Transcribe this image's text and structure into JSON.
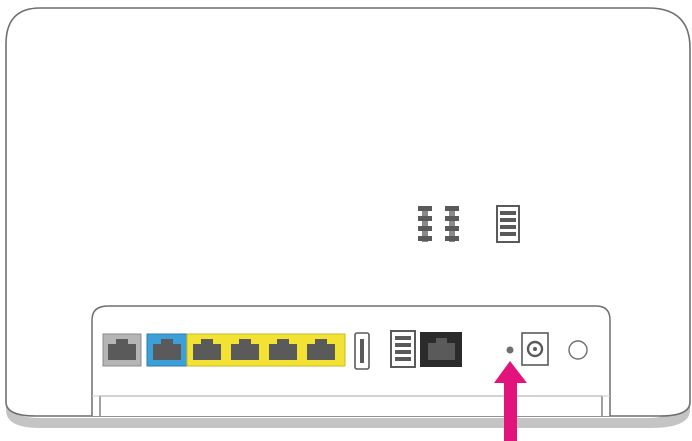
{
  "diagram": {
    "subject": "router-rear-panel",
    "colors": {
      "outline": "#6f6f6f",
      "shadow": "#c4c4c4",
      "port_gray_fill": "#b5b5b5",
      "port_blue_fill": "#3d9fd8",
      "port_yellow_fill": "#f3e234",
      "port_black_fill": "#2b2b2b",
      "port_socket": "#5a5a5a",
      "arrow": "#e2137a"
    },
    "ports": [
      {
        "id": "dsl-port",
        "color": "gray"
      },
      {
        "id": "wan-port",
        "color": "blue"
      },
      {
        "id": "lan-port-1",
        "color": "yellow"
      },
      {
        "id": "lan-port-2",
        "color": "yellow"
      },
      {
        "id": "lan-port-3",
        "color": "yellow"
      },
      {
        "id": "lan-port-4",
        "color": "yellow"
      },
      {
        "id": "usb-port",
        "color": "white"
      },
      {
        "id": "phone-port",
        "color": "white"
      },
      {
        "id": "telephone-port",
        "color": "black"
      },
      {
        "id": "reset-button",
        "color": "none"
      },
      {
        "id": "power-socket",
        "color": "white"
      },
      {
        "id": "power-button",
        "color": "white"
      }
    ],
    "highlight": {
      "target": "reset-button",
      "icon": "up-arrow-icon"
    }
  }
}
